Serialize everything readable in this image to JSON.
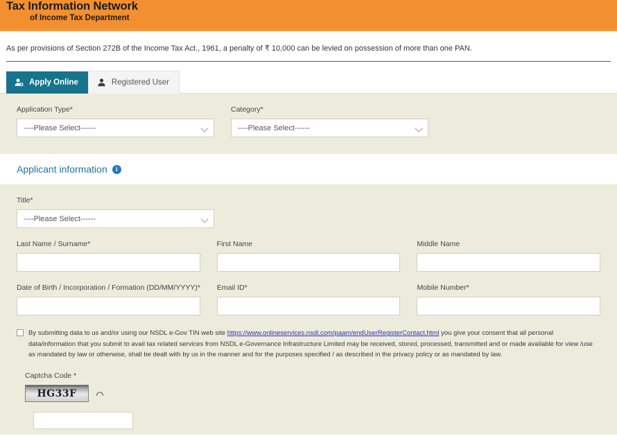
{
  "header": {
    "title_line1": "Tax Information Network",
    "title_line2": "of Income Tax Department",
    "background_color": "#f28f30"
  },
  "notice": {
    "text": "As per provisions of Section 272B of the Income Tax Act., 1961, a penalty of ₹ 10,000 can be levied on possession of more than one PAN."
  },
  "tabs": {
    "active_color": "#16748c",
    "items": [
      {
        "label": "Apply Online",
        "icon": "user-add-icon",
        "active": true
      },
      {
        "label": "Registered User",
        "icon": "user-icon",
        "active": false
      }
    ]
  },
  "application_panel": {
    "application_type": {
      "label": "Application Type*",
      "value": "----Please Select------"
    },
    "category": {
      "label": "Category*",
      "value": "----Please Select------"
    }
  },
  "applicant_section": {
    "heading": "Applicant information",
    "heading_color": "#1c7699",
    "info_icon_char": "i",
    "title_field": {
      "label": "Title*",
      "value": "----Please Select------"
    },
    "last_name": {
      "label": "Last Name / Surname*",
      "value": ""
    },
    "first_name": {
      "label": "First Name",
      "value": ""
    },
    "middle_name": {
      "label": "Middle Name",
      "value": ""
    },
    "dob": {
      "label": "Date of Birth / Incorporation / Formation (DD/MM/YYYY)*",
      "value": ""
    },
    "email": {
      "label": "Email ID*",
      "value": ""
    },
    "mobile": {
      "label": "Mobile Number*",
      "value": ""
    }
  },
  "consent": {
    "checked": false,
    "part1": "By submitting data to us and/or using our NSDL e-Gov TIN web site ",
    "link_text": "https://www.onlineservices.nsdl.com/paam/endUserRegisterContact.html",
    "part2": " you give your consent that all personal data/information that you submit to avail tax related services from NSDL e-Governance Infrastructure Limited may be received, stored, processed, transmitted and or made available for view /use as mandated by law or otherwise, shall be dealt with by us in the manner and for the purposes specified / as described in the privacy policy or as mandated by law.",
    "link_color": "#2b33b8"
  },
  "captcha": {
    "label": "Captcha Code *",
    "code": "HG33F",
    "refresh_icon": "refresh-icon",
    "input_value": ""
  }
}
